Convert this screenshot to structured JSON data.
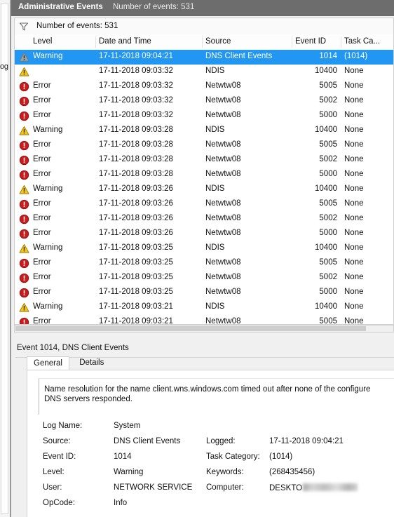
{
  "background_window": {
    "partial_text": "og"
  },
  "window": {
    "tab_label": "Administrative Events",
    "header_count": "Number of events: 531"
  },
  "filter_bar": {
    "icon": "filter-funnel-icon",
    "text": "Number of events: 531"
  },
  "list": {
    "columns": [
      {
        "key": "level",
        "label": "Level"
      },
      {
        "key": "date",
        "label": "Date and Time"
      },
      {
        "key": "source",
        "label": "Source"
      },
      {
        "key": "eid",
        "label": "Event ID"
      },
      {
        "key": "task",
        "label": "Task Ca..."
      }
    ],
    "rows": [
      {
        "icon": "warning-icon",
        "level": "Warning",
        "date": "17-11-2018 09:04:21",
        "source": "DNS Client Events",
        "eid": "1014",
        "task": "(1014)",
        "selected": true
      },
      {
        "icon": "warning-icon",
        "level": "",
        "date": "17-11-2018 09:03:32",
        "source": "NDIS",
        "eid": "10400",
        "task": "None",
        "selected": false
      },
      {
        "icon": "error-icon",
        "level": "Error",
        "date": "17-11-2018 09:03:32",
        "source": "Netwtw08",
        "eid": "5005",
        "task": "None",
        "selected": false
      },
      {
        "icon": "error-icon",
        "level": "Error",
        "date": "17-11-2018 09:03:32",
        "source": "Netwtw08",
        "eid": "5002",
        "task": "None",
        "selected": false
      },
      {
        "icon": "error-icon",
        "level": "Error",
        "date": "17-11-2018 09:03:32",
        "source": "Netwtw08",
        "eid": "5000",
        "task": "None",
        "selected": false
      },
      {
        "icon": "warning-icon",
        "level": "Warning",
        "date": "17-11-2018 09:03:28",
        "source": "NDIS",
        "eid": "10400",
        "task": "None",
        "selected": false
      },
      {
        "icon": "error-icon",
        "level": "Error",
        "date": "17-11-2018 09:03:28",
        "source": "Netwtw08",
        "eid": "5005",
        "task": "None",
        "selected": false
      },
      {
        "icon": "error-icon",
        "level": "Error",
        "date": "17-11-2018 09:03:28",
        "source": "Netwtw08",
        "eid": "5002",
        "task": "None",
        "selected": false
      },
      {
        "icon": "error-icon",
        "level": "Error",
        "date": "17-11-2018 09:03:28",
        "source": "Netwtw08",
        "eid": "5000",
        "task": "None",
        "selected": false
      },
      {
        "icon": "warning-icon",
        "level": "Warning",
        "date": "17-11-2018 09:03:26",
        "source": "NDIS",
        "eid": "10400",
        "task": "None",
        "selected": false
      },
      {
        "icon": "error-icon",
        "level": "Error",
        "date": "17-11-2018 09:03:26",
        "source": "Netwtw08",
        "eid": "5005",
        "task": "None",
        "selected": false
      },
      {
        "icon": "error-icon",
        "level": "Error",
        "date": "17-11-2018 09:03:26",
        "source": "Netwtw08",
        "eid": "5002",
        "task": "None",
        "selected": false
      },
      {
        "icon": "error-icon",
        "level": "Error",
        "date": "17-11-2018 09:03:26",
        "source": "Netwtw08",
        "eid": "5000",
        "task": "None",
        "selected": false
      },
      {
        "icon": "warning-icon",
        "level": "Warning",
        "date": "17-11-2018 09:03:25",
        "source": "NDIS",
        "eid": "10400",
        "task": "None",
        "selected": false
      },
      {
        "icon": "error-icon",
        "level": "Error",
        "date": "17-11-2018 09:03:25",
        "source": "Netwtw08",
        "eid": "5005",
        "task": "None",
        "selected": false
      },
      {
        "icon": "error-icon",
        "level": "Error",
        "date": "17-11-2018 09:03:25",
        "source": "Netwtw08",
        "eid": "5002",
        "task": "None",
        "selected": false
      },
      {
        "icon": "error-icon",
        "level": "Error",
        "date": "17-11-2018 09:03:25",
        "source": "Netwtw08",
        "eid": "5000",
        "task": "None",
        "selected": false
      },
      {
        "icon": "warning-icon",
        "level": "Warning",
        "date": "17-11-2018 09:03:21",
        "source": "NDIS",
        "eid": "10400",
        "task": "None",
        "selected": false
      },
      {
        "icon": "error-icon",
        "level": "Error",
        "date": "17-11-2018 09:03:21",
        "source": "Netwtw08",
        "eid": "5005",
        "task": "None",
        "selected": false
      }
    ]
  },
  "detail": {
    "title": "Event 1014, DNS Client Events",
    "tabs": [
      {
        "label": "General",
        "active": true
      },
      {
        "label": "Details",
        "active": false
      }
    ],
    "message_line1": "Name resolution for the name client.wns.windows.com timed out after none of the configure",
    "message_line2": "DNS servers responded.",
    "properties": [
      {
        "label": "Log Name:",
        "value": "System"
      },
      {
        "label": "Source:",
        "value": "DNS Client Events",
        "label2": "Logged:",
        "value2": "17-11-2018 09:04:21"
      },
      {
        "label": "Event ID:",
        "value": "1014",
        "label2": "Task Category:",
        "value2": "(1014)"
      },
      {
        "label": "Level:",
        "value": "Warning",
        "label2": "Keywords:",
        "value2": "(268435456)"
      },
      {
        "label": "User:",
        "value": "NETWORK SERVICE",
        "label2": "Computer:",
        "value2": "DESKTO",
        "value2_redacted": true
      },
      {
        "label": "OpCode:",
        "value": "Info"
      }
    ]
  },
  "colors": {
    "selection_blue": "#2196f3",
    "header_grey": "#6d6d6d",
    "warning_yellow": "#f5c518",
    "error_red": "#cc1b1b"
  }
}
